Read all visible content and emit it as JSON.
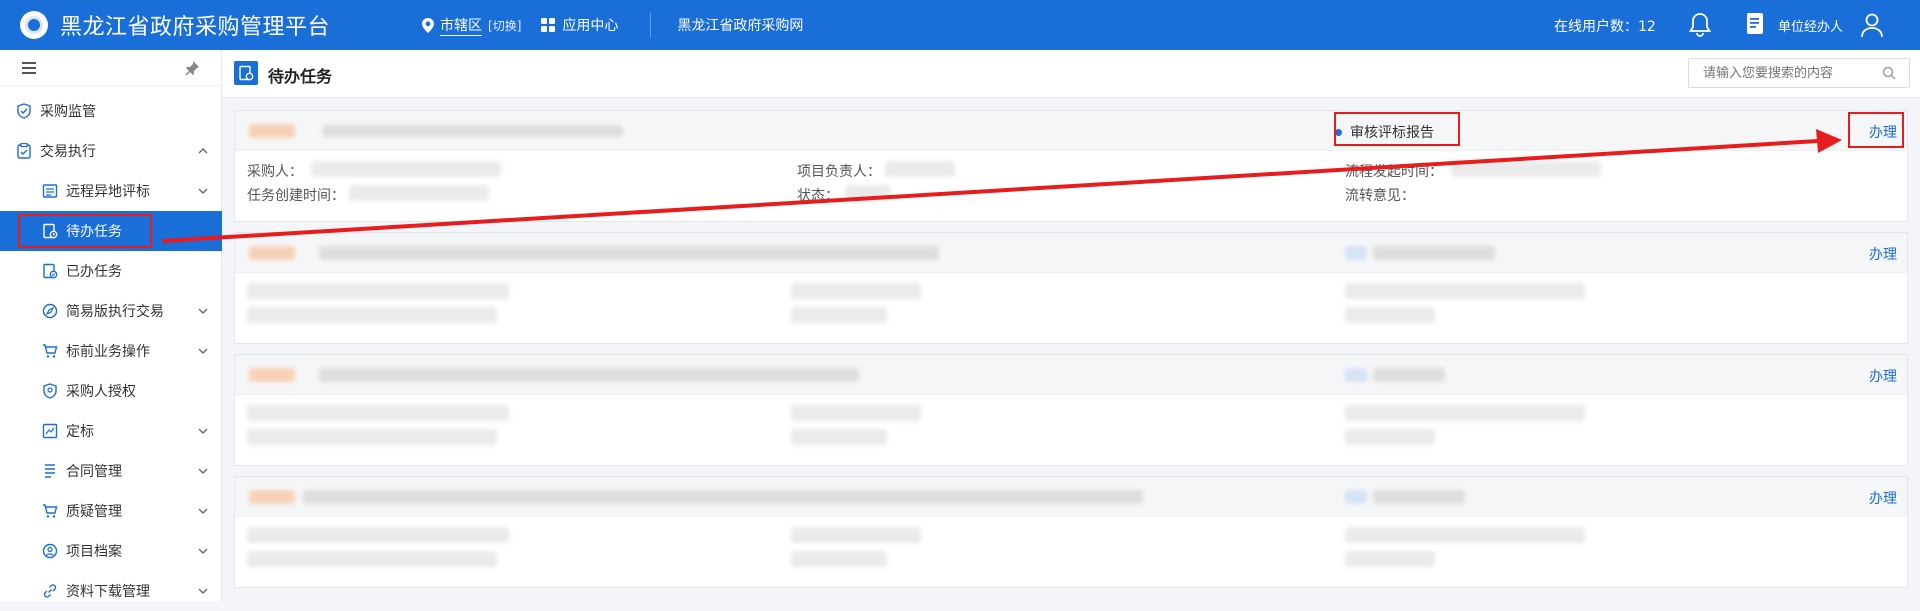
{
  "header": {
    "app_title": "黑龙江省政府采购管理平台",
    "region_name": "市辖区",
    "region_switch": "[切换]",
    "app_center": "应用中心",
    "site_link": "黑龙江省政府采购网",
    "online_users": "在线用户数：12",
    "user_name": "单位经办人"
  },
  "sidebar": {
    "items": [
      {
        "label": "采购监管"
      },
      {
        "label": "交易执行"
      },
      {
        "label": "远程异地评标"
      },
      {
        "label": "待办任务"
      },
      {
        "label": "已办任务"
      },
      {
        "label": "简易版执行交易"
      },
      {
        "label": "标前业务操作"
      },
      {
        "label": "采购人授权"
      },
      {
        "label": "定标"
      },
      {
        "label": "合同管理"
      },
      {
        "label": "质疑管理"
      },
      {
        "label": "项目档案"
      },
      {
        "label": "资料下载管理"
      }
    ]
  },
  "main": {
    "title": "待办任务",
    "search_placeholder": "请输入您要搜索的内容",
    "card1": {
      "status": "审核评标报告",
      "action": "办理",
      "purchaser_label": "采购人：",
      "manager_label": "项目负责人：",
      "flow_time_label": "流程发起时间：",
      "created_label": "任务创建时间：",
      "state_label": "状态：",
      "opinion_label": "流转意见："
    },
    "card_actions": [
      "办理",
      "办理",
      "办理"
    ]
  },
  "colors": {
    "brand": "#1a6ed8",
    "highlight": "#e81c1c"
  }
}
